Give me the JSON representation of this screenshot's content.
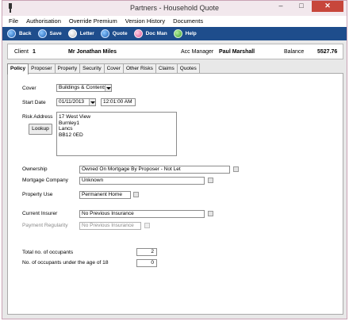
{
  "window": {
    "title": "Partners - Household Quote",
    "minimize": "–",
    "maximize": "□",
    "close": "✕"
  },
  "menu": [
    "File",
    "Authorisation",
    "Override Premium",
    "Version History",
    "Documents"
  ],
  "toolbar": [
    {
      "label": "Back",
      "icon": "back-arrow-icon",
      "color": "blue"
    },
    {
      "label": "Save",
      "icon": "save-icon",
      "color": "blue"
    },
    {
      "label": "Letter",
      "icon": "letter-icon",
      "color": "white"
    },
    {
      "label": "Quote",
      "icon": "quote-icon",
      "color": "blue"
    },
    {
      "label": "Doc Man",
      "icon": "doc-man-icon",
      "color": "pink"
    },
    {
      "label": "Help",
      "icon": "help-icon",
      "color": "green"
    }
  ],
  "client": {
    "client_label": "Client",
    "client_id": "1",
    "client_name": "Mr Jonathan Miles",
    "acc_manager_label": "Acc Manager",
    "acc_manager": "Paul Marshall",
    "balance_label": "Balance",
    "balance": "5527.76"
  },
  "tabs": [
    "Policy",
    "Proposer",
    "Property",
    "Security",
    "Cover",
    "Other Risks",
    "Claims",
    "Quotes"
  ],
  "active_tab": "Policy",
  "form": {
    "cover_label": "Cover",
    "cover_value": "Buildings & Contents",
    "start_date_label": "Start Date",
    "start_date": "01/11/2013",
    "start_time": "12:01:00 AM",
    "risk_address_label": "Risk Address",
    "lookup_button": "Lookup",
    "address_lines": [
      "17 West View",
      "Burnley1",
      "Lancs",
      "BB12 0ED"
    ],
    "ownership_label": "Ownership",
    "ownership_value": "Owned On Mortgage By Proposer - Not Let",
    "mortgage_label": "Mortgage Company",
    "mortgage_value": "Unknown",
    "property_use_label": "Property Use",
    "property_use_value": "Permanent Home",
    "current_insurer_label": "Current Insurer",
    "current_insurer_value": "No Previous Insurance",
    "payment_regularity_label": "Payment Regularity",
    "payment_regularity_value": "No Previous Insurance",
    "occupants_label": "Total no. of occupants",
    "occupants_value": "2",
    "under18_label": "No. of occupants under the age of 18",
    "under18_value": "0"
  }
}
